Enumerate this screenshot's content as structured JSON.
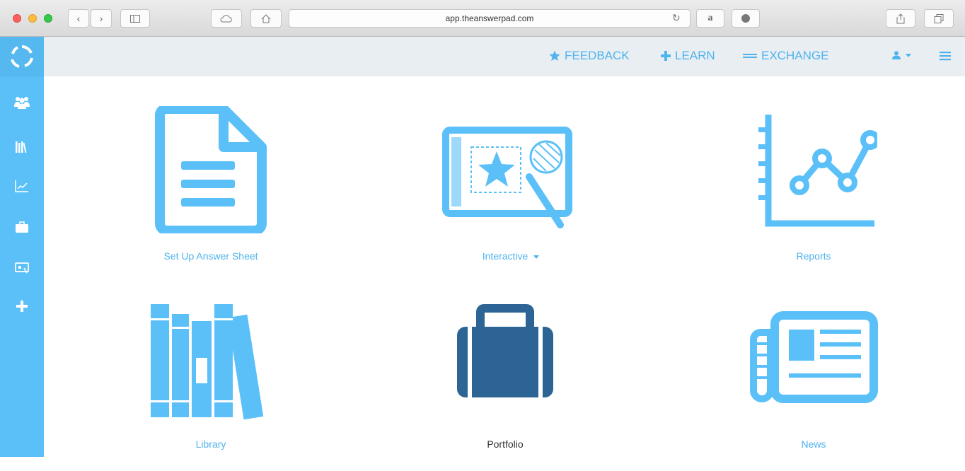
{
  "browser": {
    "url": "app.theanswerpad.com"
  },
  "topnav": {
    "feedback": "FEEDBACK",
    "learn": "LEARN",
    "exchange": "EXCHANGE"
  },
  "tiles": [
    {
      "label": "Set Up Answer Sheet"
    },
    {
      "label": "Interactive"
    },
    {
      "label": "Reports"
    },
    {
      "label": "Library"
    },
    {
      "label": "Portfolio"
    },
    {
      "label": "News"
    }
  ],
  "colors": {
    "accent": "#5bc0f8",
    "accent_text": "#4fb3ee",
    "portfolio": "#2c6595",
    "topbar_bg": "#e9eef2"
  }
}
